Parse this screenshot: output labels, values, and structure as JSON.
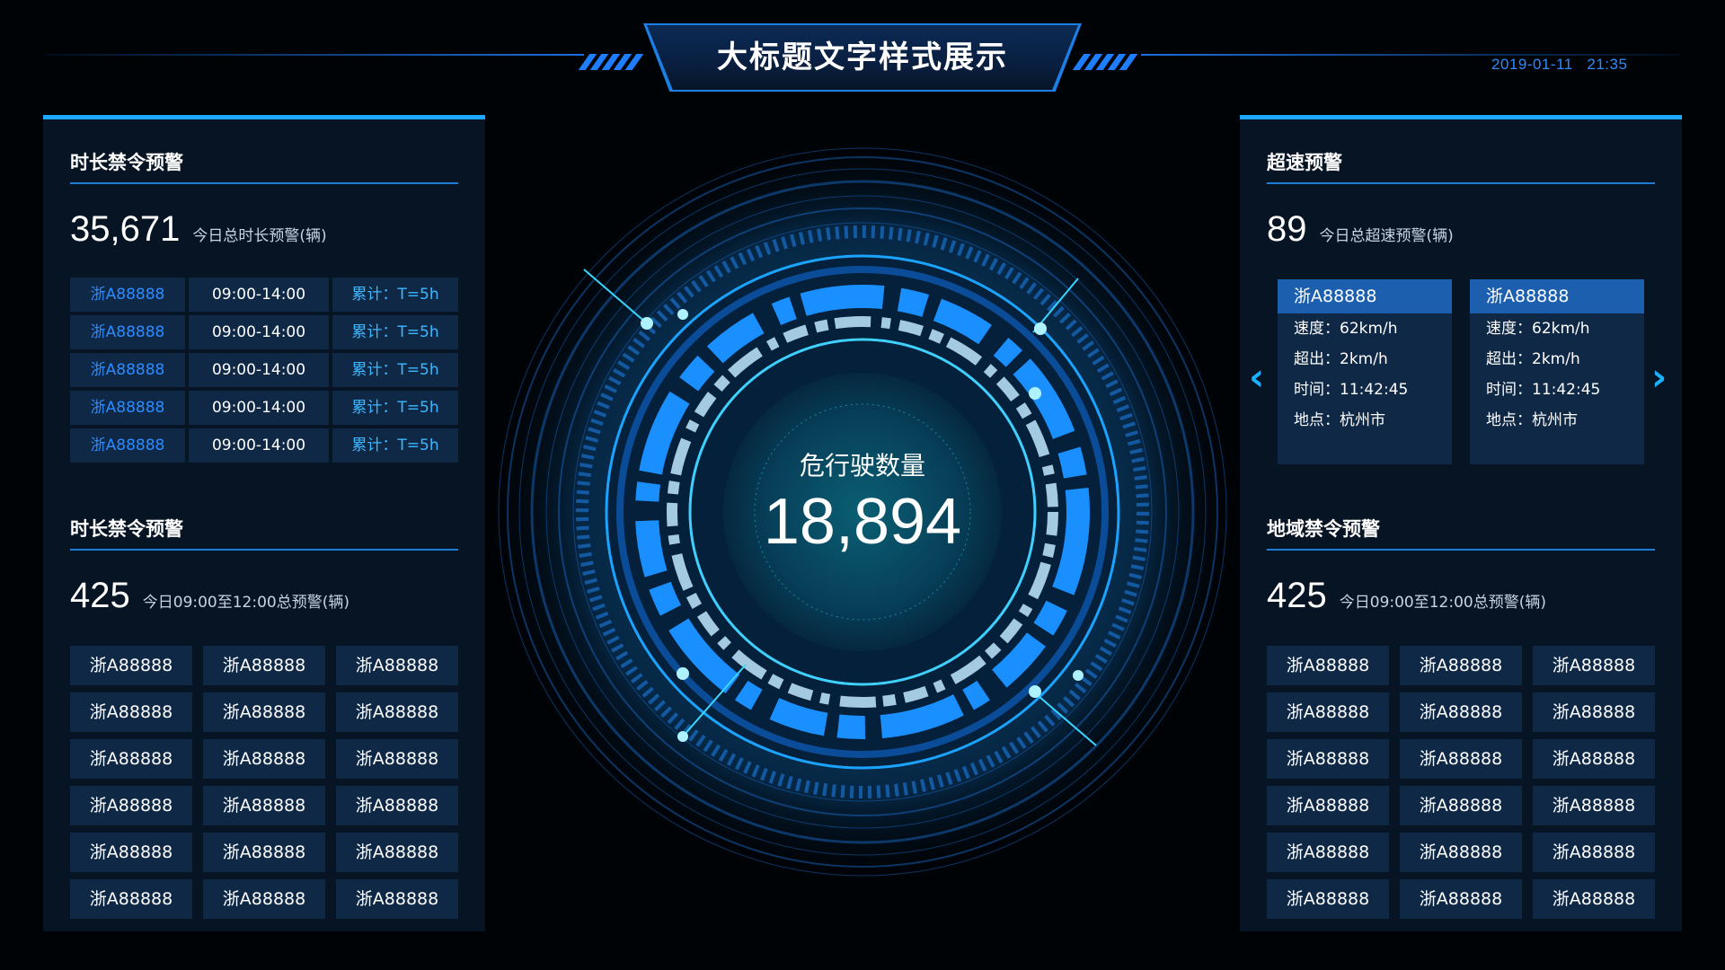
{
  "header": {
    "title": "大标题文字样式展示",
    "date": "2019-01-11",
    "time": "21:35"
  },
  "left_panel": {
    "duration_section": {
      "title": "时长禁令预警",
      "total": "35,671",
      "total_label": "今日总时长预警(辆)",
      "rows": [
        {
          "plate": "浙A88888",
          "period": "09:00-14:00",
          "accum": "累计：T=5h"
        },
        {
          "plate": "浙A88888",
          "period": "09:00-14:00",
          "accum": "累计：T=5h"
        },
        {
          "plate": "浙A88888",
          "period": "09:00-14:00",
          "accum": "累计：T=5h"
        },
        {
          "plate": "浙A88888",
          "period": "09:00-14:00",
          "accum": "累计：T=5h"
        },
        {
          "plate": "浙A88888",
          "period": "09:00-14:00",
          "accum": "累计：T=5h"
        }
      ]
    },
    "duration_section_2": {
      "title": "时长禁令预警",
      "total": "425",
      "total_label": "今日09:00至12:00总预警(辆)",
      "plates": [
        "浙A88888",
        "浙A88888",
        "浙A88888",
        "浙A88888",
        "浙A88888",
        "浙A88888",
        "浙A88888",
        "浙A88888",
        "浙A88888",
        "浙A88888",
        "浙A88888",
        "浙A88888",
        "浙A88888",
        "浙A88888",
        "浙A88888",
        "浙A88888",
        "浙A88888",
        "浙A88888"
      ]
    }
  },
  "center": {
    "label": "危行驶数量",
    "value": "18,894"
  },
  "right_panel": {
    "speed_section": {
      "title": "超速预警",
      "total": "89",
      "total_label": "今日总超速预警(辆)",
      "cards": [
        {
          "plate": "浙A88888",
          "speed": "速度：62km/h",
          "over": "超出：2km/h",
          "time": "时间：11:42:45",
          "place": "地点：杭州市"
        },
        {
          "plate": "浙A88888",
          "speed": "速度：62km/h",
          "over": "超出：2km/h",
          "time": "时间：11:42:45",
          "place": "地点：杭州市"
        }
      ],
      "prev_icon": "‹",
      "next_icon": "›"
    },
    "region_section": {
      "title": "地域禁令预警",
      "total": "425",
      "total_label": "今日09:00至12:00总预警(辆)",
      "plates": [
        "浙A88888",
        "浙A88888",
        "浙A88888",
        "浙A88888",
        "浙A88888",
        "浙A88888",
        "浙A88888",
        "浙A88888",
        "浙A88888",
        "浙A88888",
        "浙A88888",
        "浙A88888",
        "浙A88888",
        "浙A88888",
        "浙A88888",
        "浙A88888",
        "浙A88888",
        "浙A88888"
      ]
    }
  },
  "colors": {
    "accent": "#1ca8ff",
    "plate_blue": "#2c8bff",
    "cell_bg": "#0f2846",
    "panel_bg": "#071424"
  }
}
